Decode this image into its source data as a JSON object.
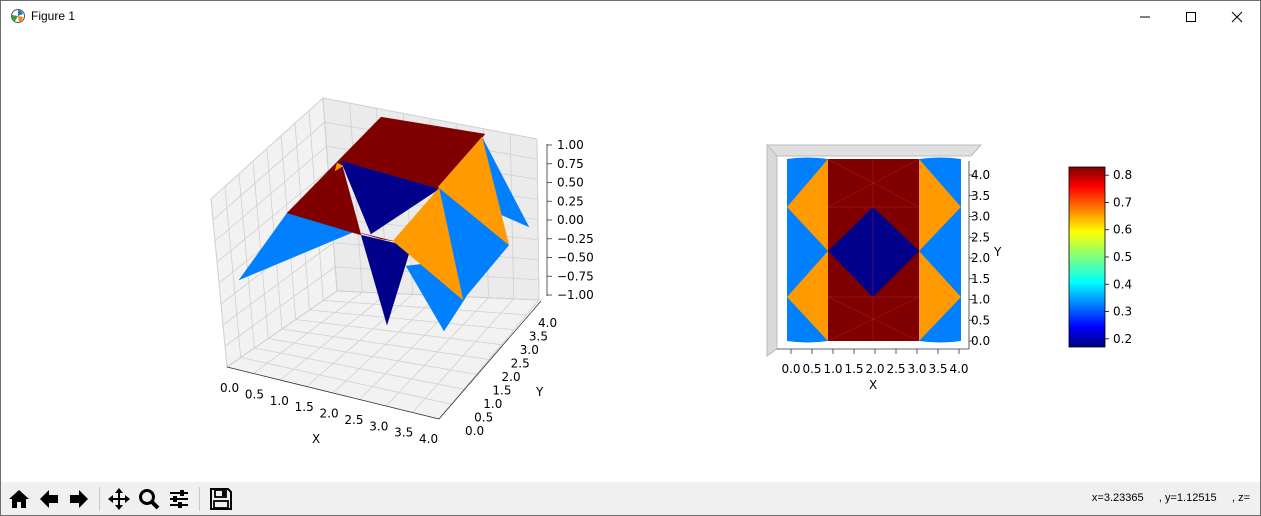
{
  "window": {
    "title": "Figure 1",
    "icon": "matplotlib-icon",
    "controls": [
      "minimize-icon",
      "maximize-icon",
      "close-icon"
    ]
  },
  "colormap": "jet",
  "colors": {
    "dark_red": "#800000",
    "dark_blue": "#00008b",
    "orange": "#ff9a00",
    "light_blue": "#0080ff"
  },
  "chart_data": [
    {
      "type": "surface3d",
      "xlabel": "X",
      "ylabel": "Y",
      "xticks": [
        "0.0",
        "0.5",
        "1.0",
        "1.5",
        "2.0",
        "2.5",
        "3.0",
        "3.5",
        "4.0"
      ],
      "yticks": [
        "0.0",
        "0.5",
        "1.0",
        "1.5",
        "2.0",
        "2.5",
        "3.0",
        "3.5",
        "4.0"
      ],
      "zticks": [
        "1.00",
        "0.75",
        "0.50",
        "0.25",
        "0.00",
        "−0.25",
        "−0.50",
        "−0.75",
        "−1.00"
      ],
      "xlim": [
        0,
        4
      ],
      "ylim": [
        0,
        4
      ],
      "zlim": [
        -1,
        1
      ]
    },
    {
      "type": "heatmap",
      "xlabel": "X",
      "ylabel": "Y",
      "xticks": [
        "0.0",
        "0.5",
        "1.0",
        "1.5",
        "2.0",
        "2.5",
        "3.0",
        "3.5",
        "4.0"
      ],
      "yticks": [
        "4.0",
        "3.5",
        "3.0",
        "2.5",
        "2.0",
        "1.5",
        "1.0",
        "0.5",
        "0.0"
      ],
      "xlim": [
        0,
        4
      ],
      "ylim": [
        0,
        4
      ],
      "colorbar": {
        "ticks": [
          "0.8",
          "0.7",
          "0.6",
          "0.5",
          "0.4",
          "0.3",
          "0.2"
        ],
        "range": [
          0.17,
          0.83
        ]
      }
    }
  ],
  "toolbar": {
    "buttons": [
      "home-icon",
      "back-icon",
      "forward-icon",
      "pan-icon",
      "zoom-icon",
      "configure-subplots-icon",
      "save-icon"
    ]
  },
  "status": {
    "coords": "x=3.23365     , y=1.12515     , z="
  }
}
